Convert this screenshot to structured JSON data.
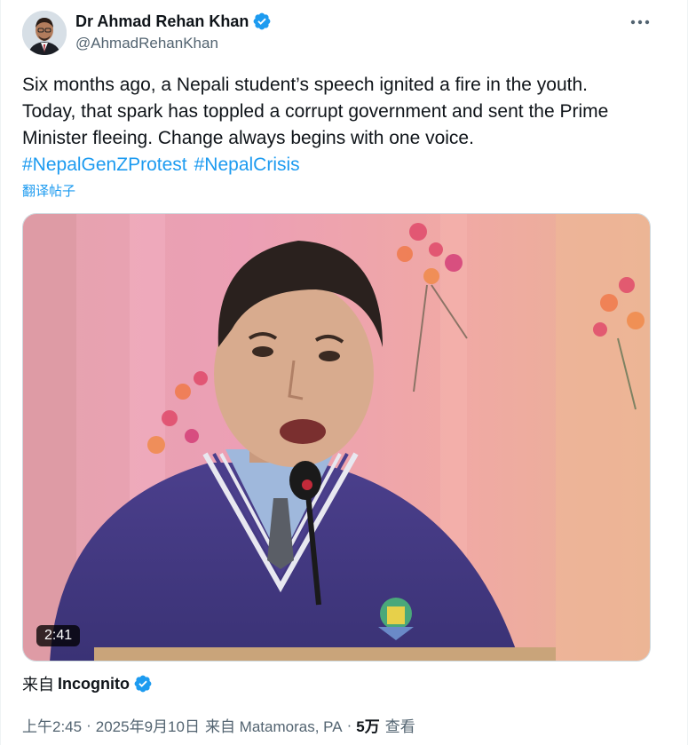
{
  "author": {
    "display_name": "Dr Ahmad Rehan Khan",
    "handle": "@AhmadRehanKhan",
    "verified": true
  },
  "tweet": {
    "lines": [
      "Six months ago, a Nepali student’s speech ignited a fire in the youth.",
      "Today, that spark has toppled a corrupt government and sent the Prime",
      "Minister fleeing. Change always begins with one voice."
    ],
    "hashtags": [
      "#NepalGenZProtest",
      "#NepalCrisis"
    ],
    "translate_label": "翻译帖子"
  },
  "media": {
    "duration": "2:41"
  },
  "source": {
    "prefix": "来自",
    "name": "Incognito",
    "verified": true
  },
  "meta": {
    "time": "上午2:45",
    "date": "2025年9月10日",
    "location": "来自 Matamoras, PA",
    "views_count": "5万",
    "views_label": "查看"
  },
  "colors": {
    "accent": "#1d9bf0",
    "text": "#0f1419",
    "secondary": "#536471"
  }
}
